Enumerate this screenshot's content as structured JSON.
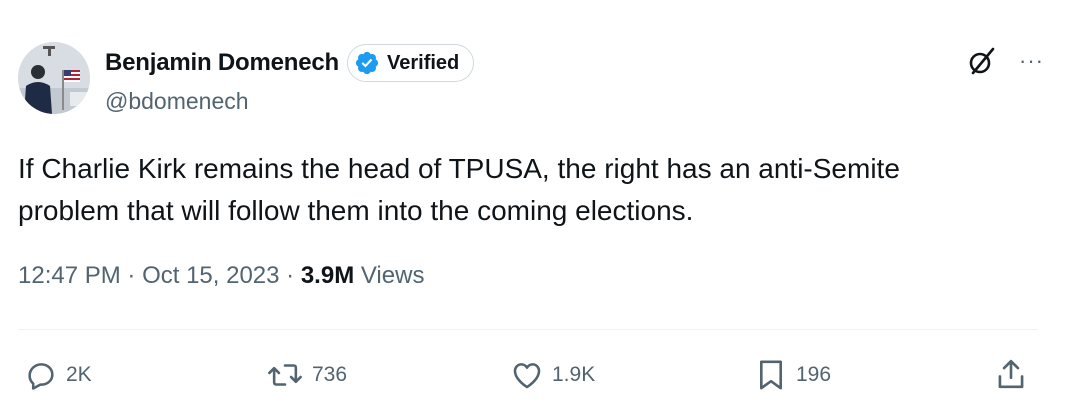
{
  "author": {
    "display_name": "Benjamin Domenech",
    "handle": "@bdomenech",
    "verified_label": "Verified",
    "verified_color": "#1d9bf0"
  },
  "tweet": {
    "text_line_1": "If Charlie Kirk remains the head of TPUSA, the right has an anti-Semite",
    "text_line_2": "problem that will follow them into the coming elections.",
    "time": "12:47 PM",
    "separator": " · ",
    "date": "Oct 15, 2023",
    "views_count": "3.9M",
    "views_label": " Views"
  },
  "actions": {
    "replies": "2K",
    "reposts": "736",
    "likes": "1.9K",
    "bookmarks": "196"
  },
  "icons": {
    "grok": "grok-icon",
    "more": "more-icon",
    "reply": "reply-icon",
    "repost": "repost-icon",
    "like": "like-icon",
    "bookmark": "bookmark-icon",
    "share": "share-icon"
  },
  "colors": {
    "text_primary": "#0f1419",
    "text_secondary": "#536471",
    "divider": "#eff3f4"
  }
}
